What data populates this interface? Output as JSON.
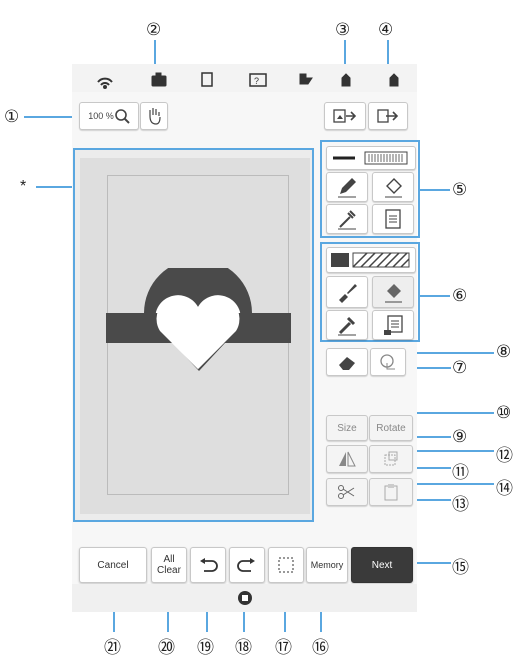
{
  "toolbar": {
    "zoom_label": "100 %"
  },
  "panel": {
    "size_label": "Size",
    "rotate_label": "Rotate"
  },
  "bottom_bar": {
    "cancel_label": "Cancel",
    "all_clear_label_1": "All",
    "all_clear_label_2": "Clear",
    "memory_label": "Memory",
    "next_label": "Next"
  },
  "annotations": {
    "asterisk": "*",
    "callouts": [
      "①",
      "②",
      "③",
      "④",
      "⑤",
      "⑥",
      "⑦",
      "⑧",
      "⑨",
      "⑩",
      "⑪",
      "⑫",
      "⑬",
      "⑭",
      "⑮",
      "⑯",
      "⑰",
      "⑱",
      "⑲",
      "⑳",
      "㉑"
    ]
  },
  "colors": {
    "accent_line": "#5aa7e0",
    "canvas_bg": "#dedede",
    "shape_fill": "#4a4a4a",
    "next_button_bg": "#3a3a3a"
  }
}
